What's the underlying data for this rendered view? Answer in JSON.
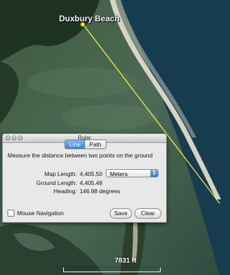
{
  "map": {
    "place_label": "Duxbury Beach",
    "scale_label": "7831 ft",
    "measure_line_color": "#ffff33",
    "icons": [
      "placemark-pin-icon"
    ]
  },
  "ruler": {
    "title": "Ruler",
    "tabs": [
      {
        "label": "Line",
        "active": true
      },
      {
        "label": "Path",
        "active": false
      }
    ],
    "description": "Measure the distance between two points on the ground",
    "map_length_label": "Map Length:",
    "map_length_value": "4,405.50",
    "unit_selected": "Meters",
    "ground_length_label": "Ground Length:",
    "ground_length_value": "4,405.48",
    "heading_label": "Heading:",
    "heading_value": "146.98 degrees",
    "mouse_nav_label": "Mouse Navigation",
    "mouse_nav_checked": false,
    "save_label": "Save",
    "clear_label": "Clear"
  }
}
